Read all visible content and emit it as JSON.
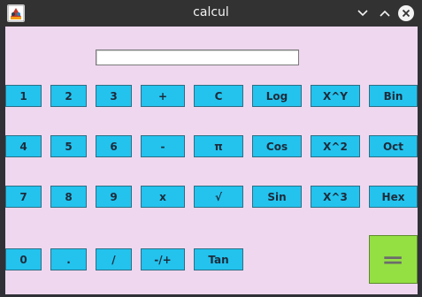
{
  "window": {
    "title": "calcul"
  },
  "display": {
    "value": ""
  },
  "buttons": {
    "b1": "1",
    "b2": "2",
    "b3": "3",
    "plus": "+",
    "clear": "C",
    "log": "Log",
    "xpowy": "X^Y",
    "bin": "Bin",
    "b4": "4",
    "b5": "5",
    "b6": "6",
    "minus": "-",
    "pi": "π",
    "cos": "Cos",
    "xsq": "X^2",
    "oct": "Oct",
    "b7": "7",
    "b8": "8",
    "b9": "9",
    "times": "x",
    "sqrt": "√",
    "sin": "Sin",
    "xcube": "X^3",
    "hex": "Hex",
    "b0": "0",
    "dot": ".",
    "divide": "/",
    "negate": "-/+",
    "tan": "Tan",
    "equals": "="
  },
  "colors": {
    "content_bg": "#efd7ef",
    "button_bg": "#23c3ee",
    "equals_bg": "#94e043"
  }
}
